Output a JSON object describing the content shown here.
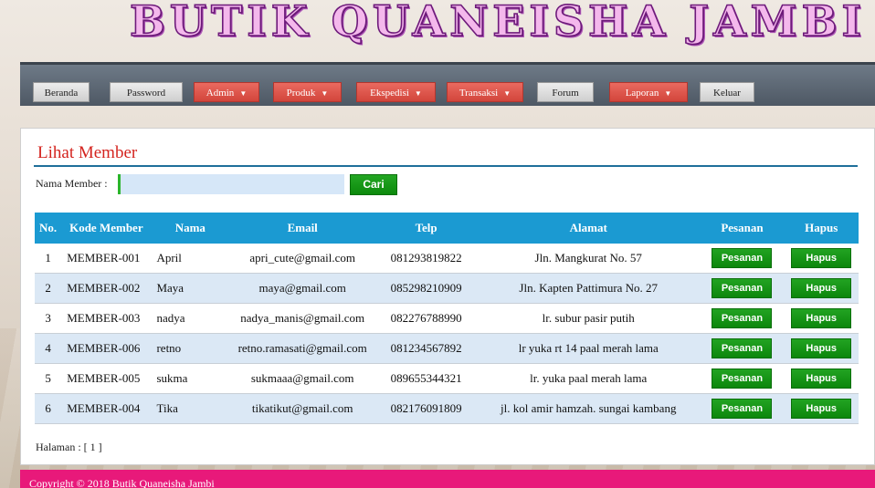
{
  "header": {
    "banner_title": "BUTIK QUANEISHA JAMBI"
  },
  "nav": {
    "beranda": "Beranda",
    "password": "Password",
    "admin": "Admin",
    "produk": "Produk",
    "ekspedisi": "Ekspedisi",
    "transaksi": "Transaksi",
    "forum": "Forum",
    "laporan": "Laporan",
    "keluar": "Keluar",
    "caret": "▼"
  },
  "page": {
    "heading": "Lihat Member",
    "search_label": "Nama Member :",
    "search_value": "",
    "search_button": "Cari"
  },
  "table": {
    "headers": [
      "No.",
      "Kode Member",
      "Nama",
      "Email",
      "Telp",
      "Alamat",
      "Pesanan",
      "Hapus"
    ],
    "rows": [
      {
        "no": "1",
        "kode": "MEMBER-001",
        "nama": "April",
        "email": "apri_cute@gmail.com",
        "telp": "081293819822",
        "alamat": "Jln. Mangkurat No. 57",
        "pesanan": "Pesanan",
        "hapus": "Hapus"
      },
      {
        "no": "2",
        "kode": "MEMBER-002",
        "nama": "Maya",
        "email": "maya@gmail.com",
        "telp": "085298210909",
        "alamat": "Jln. Kapten Pattimura No. 27",
        "pesanan": "Pesanan",
        "hapus": "Hapus"
      },
      {
        "no": "3",
        "kode": "MEMBER-003",
        "nama": "nadya",
        "email": "nadya_manis@gmail.com",
        "telp": "082276788990",
        "alamat": "lr. subur pasir putih",
        "pesanan": "Pesanan",
        "hapus": "Hapus"
      },
      {
        "no": "4",
        "kode": "MEMBER-006",
        "nama": "retno",
        "email": "retno.ramasati@gmail.com",
        "telp": "081234567892",
        "alamat": "lr yuka rt 14 paal merah lama",
        "pesanan": "Pesanan",
        "hapus": "Hapus"
      },
      {
        "no": "5",
        "kode": "MEMBER-005",
        "nama": "sukma",
        "email": "sukmaaa@gmail.com",
        "telp": "089655344321",
        "alamat": "lr. yuka paal merah lama",
        "pesanan": "Pesanan",
        "hapus": "Hapus"
      },
      {
        "no": "6",
        "kode": "MEMBER-004",
        "nama": "Tika",
        "email": "tikatikut@gmail.com",
        "telp": "082176091809",
        "alamat": "jl. kol amir hamzah. sungai kambang",
        "pesanan": "Pesanan",
        "hapus": "Hapus"
      }
    ]
  },
  "pager": {
    "text": "Halaman : [ 1 ]"
  },
  "footer": {
    "copyright": "Copyright © 2018 Butik Quaneisha Jambi"
  },
  "colors": {
    "nav_red": "#d2453b",
    "table_header": "#1b9ad2",
    "row_alt": "#dbe8f5",
    "action_green": "#0c870c",
    "heading_red": "#d4241f",
    "footer_pink": "#e8197a",
    "banner_pink": "#f4b8ec"
  }
}
